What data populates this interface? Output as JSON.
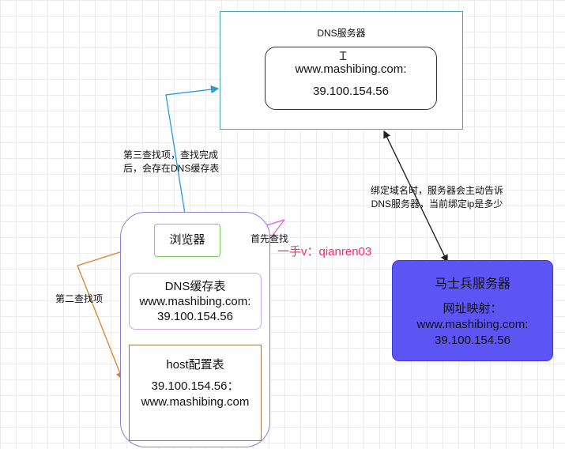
{
  "dns_server": {
    "title": "DNS服务器",
    "record_domain": "www.mashibing.com:",
    "record_ip": "39.100.154.56"
  },
  "browser": {
    "label": "浏览器"
  },
  "dns_cache": {
    "title": "DNS缓存表",
    "domain": "www.mashibing.com:",
    "ip": "39.100.154.56"
  },
  "host_table": {
    "title": "host配置表",
    "ip": "39.100.154.56：",
    "domain": "www.mashibing.com"
  },
  "msb_server": {
    "title": "马士兵服务器",
    "map_label": "网址映射：",
    "domain": "www.mashibing.com:",
    "ip": "39.100.154.56"
  },
  "labels": {
    "third": "第三查找项，查找完成后，会存在DNS缓存表",
    "second": "第二查找项",
    "first": "首先查找",
    "bind_line1": "绑定域名时，服务器会主动告诉",
    "bind_line2": "DNS服务器，当前绑定ip是多少",
    "watermark": "一手v：qianren03"
  },
  "colors": {
    "dns_server_border": "#4aa7a3",
    "browser_container_border": "#8a7fe0",
    "browser_box_border": "#7bcf5c",
    "dns_cache_border": "#c9a7e6",
    "host_table_border": "#9c7a52",
    "msb_server_fill": "#5c55f3",
    "edge_blue": "#2a9bd6",
    "edge_orange": "#d9822b",
    "edge_magenta": "#e25bd8",
    "edge_black": "#222222",
    "watermark": "#ef2f6c"
  }
}
